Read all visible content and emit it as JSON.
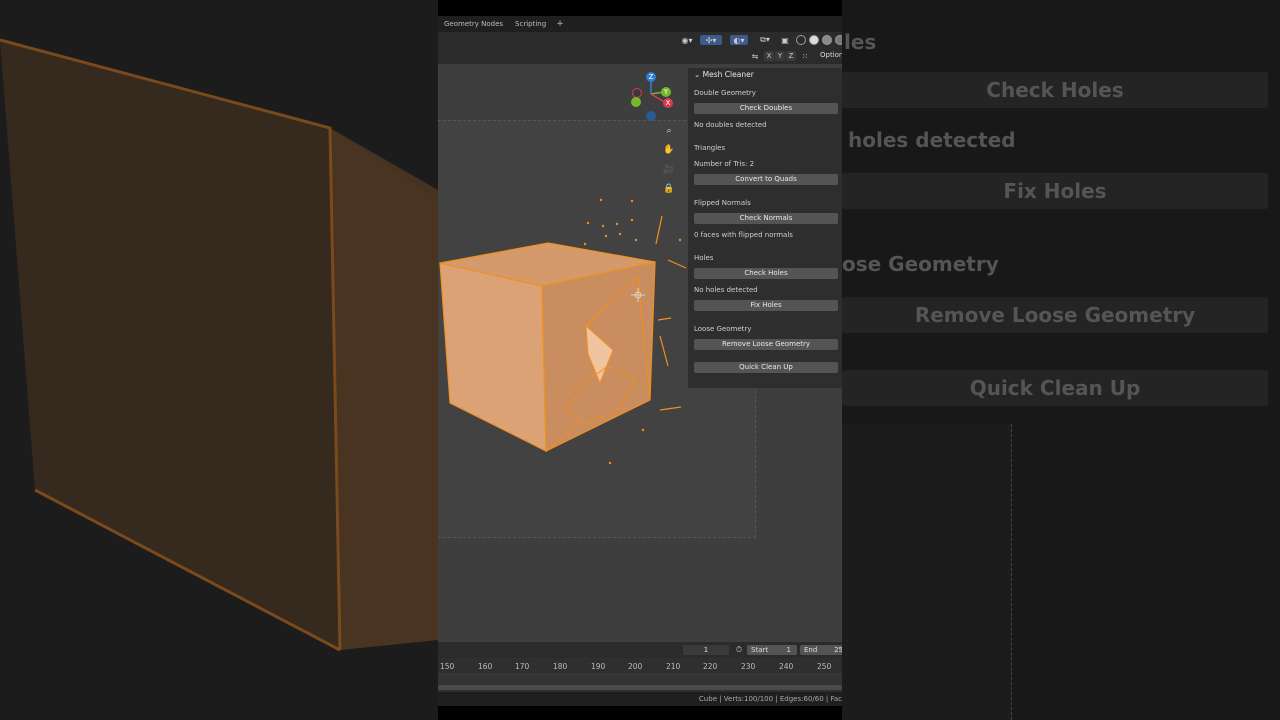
{
  "workspace_tabs": [
    "Geometry Nodes",
    "Scripting"
  ],
  "workspace_add": "+",
  "header": {
    "axes": [
      "X",
      "Y",
      "Z"
    ],
    "options_label": "Option"
  },
  "gizmo": {
    "z": "Z",
    "y": "Y",
    "x": "X"
  },
  "panel": {
    "title": "Mesh Cleaner",
    "double_geometry": {
      "label": "Double Geometry",
      "button": "Check Doubles",
      "status": "No doubles detected"
    },
    "triangles": {
      "label": "Triangles",
      "count": "Number of Tris: 2",
      "button": "Convert to Quads"
    },
    "flipped_normals": {
      "label": "Flipped Normals",
      "button": "Check Normals",
      "status": "0 faces with flipped normals"
    },
    "holes": {
      "label": "Holes",
      "check_button": "Check Holes",
      "status": "No holes detected",
      "fix_button": "Fix Holes"
    },
    "loose_geometry": {
      "label": "Loose Geometry",
      "button": "Remove Loose Geometry"
    },
    "quick_cleanup": "Quick Clean Up"
  },
  "timeline": {
    "current_frame": "1",
    "start_label": "Start",
    "start_value": "1",
    "end_label": "End",
    "end_value": "25",
    "ticks": [
      "150",
      "160",
      "170",
      "180",
      "190",
      "200",
      "210",
      "220",
      "230",
      "240",
      "250"
    ]
  },
  "status": "Cube | Verts:100/100 | Edges:60/60 | Fac",
  "blurred_right": {
    "check_holes": "Check Holes",
    "holes_detected": "holes detected",
    "fix_holes": "Fix Holes",
    "loose_geometry": "ose Geometry",
    "remove_loose": "Remove Loose Geometry",
    "quick_cleanup": "Quick Clean Up",
    "top_fragment": "les"
  },
  "colors": {
    "mesh_fill": "#d9a173",
    "mesh_edge": "#f0901e",
    "gizmo_z": "#2f7fd6",
    "gizmo_y": "#75b82c",
    "gizmo_x": "#d83b4f"
  }
}
